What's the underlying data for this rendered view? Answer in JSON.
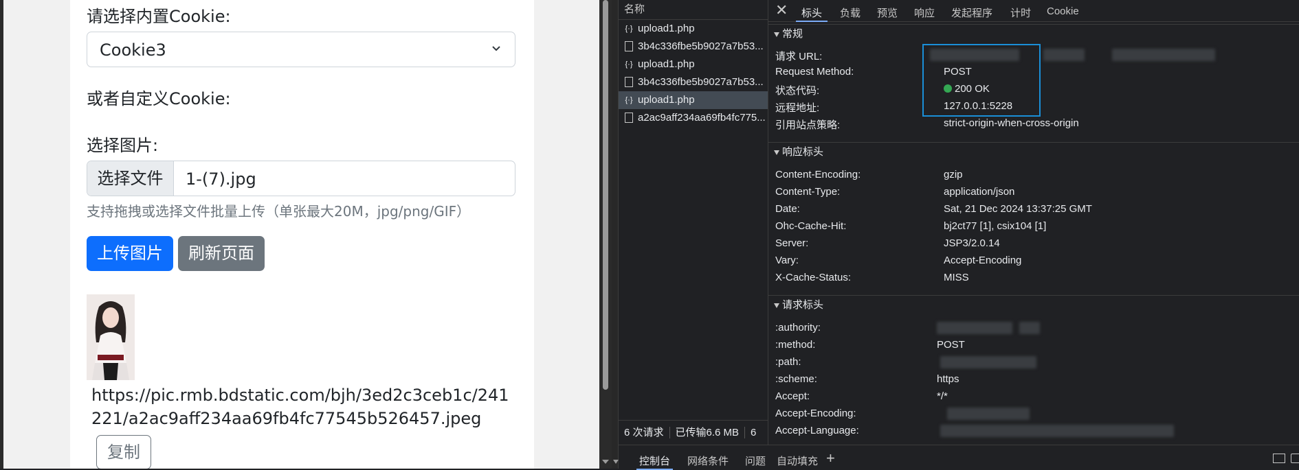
{
  "page": {
    "builtin_cookie_label": "请选择内置Cookie:",
    "cookie_select_value": "Cookie3",
    "custom_cookie_label": "或者自定义Cookie:",
    "choose_image_label": "选择图片:",
    "file_button_label": "选择文件",
    "file_name": "1-(7).jpg",
    "upload_hint": "支持拖拽或选择文件批量上传（单张最大20M，jpg/png/GIF）",
    "upload_button": "上传图片",
    "refresh_button": "刷新页面",
    "result_url": "https://pic.rmb.bdstatic.com/bjh/3ed2c3ceb1c/241221/a2ac9aff234aa69fb4fc77545b526457.jpeg",
    "copy_button": "复制"
  },
  "devtools": {
    "request_list": {
      "header": "名称",
      "rows": [
        {
          "name": "upload1.php",
          "icon": "xhr-icon",
          "selected": false
        },
        {
          "name": "3b4c336fbe5b9027a7b53...",
          "icon": "document-icon",
          "selected": false
        },
        {
          "name": "upload1.php",
          "icon": "xhr-icon",
          "selected": false
        },
        {
          "name": "3b4c336fbe5b9027a7b53...",
          "icon": "document-icon",
          "selected": false
        },
        {
          "name": "upload1.php",
          "icon": "xhr-icon",
          "selected": true
        },
        {
          "name": "a2ac9aff234aa69fb4fc775...",
          "icon": "document-icon",
          "selected": false
        }
      ],
      "summary": {
        "requests": "6 次请求",
        "transferred": "已传输6.6 MB",
        "more": "6"
      }
    },
    "tabs": [
      "标头",
      "负载",
      "预览",
      "响应",
      "发起程序",
      "计时",
      "Cookie"
    ],
    "active_tab": "标头",
    "general": {
      "title": "常规",
      "request_url_key": "请求 URL:",
      "request_method_key": "Request Method:",
      "request_method_value": "POST",
      "status_code_key": "状态代码:",
      "status_code_value": "200 OK",
      "remote_address_key": "远程地址:",
      "remote_address_value": "127.0.0.1:5228",
      "referrer_policy_key": "引用站点策略:",
      "referrer_policy_value": "strict-origin-when-cross-origin"
    },
    "response_headers": {
      "title": "响应标头",
      "rows": [
        {
          "k": "Content-Encoding:",
          "v": "gzip"
        },
        {
          "k": "Content-Type:",
          "v": "application/json"
        },
        {
          "k": "Date:",
          "v": "Sat, 21 Dec 2024 13:37:25 GMT"
        },
        {
          "k": "Ohc-Cache-Hit:",
          "v": "bj2ct77 [1], csix104 [1]"
        },
        {
          "k": "Server:",
          "v": "JSP3/2.0.14"
        },
        {
          "k": "Vary:",
          "v": "Accept-Encoding"
        },
        {
          "k": "X-Cache-Status:",
          "v": "MISS"
        }
      ]
    },
    "request_headers": {
      "title": "请求标头",
      "rows": [
        {
          "k": ":authority:",
          "v": ""
        },
        {
          "k": ":method:",
          "v": "POST"
        },
        {
          "k": ":path:",
          "v": ""
        },
        {
          "k": ":scheme:",
          "v": "https"
        },
        {
          "k": "Accept:",
          "v": "*/*"
        },
        {
          "k": "Accept-Encoding:",
          "v": ""
        },
        {
          "k": "Accept-Language:",
          "v": ""
        }
      ]
    },
    "drawer_tabs": [
      "控制台",
      "网络条件",
      "问题",
      "自动填充"
    ],
    "colors": {
      "accent": "#7cacf8",
      "highlight": "#1a8fd8",
      "status_ok": "#34a853",
      "primary_button": "#0d6efd"
    }
  }
}
